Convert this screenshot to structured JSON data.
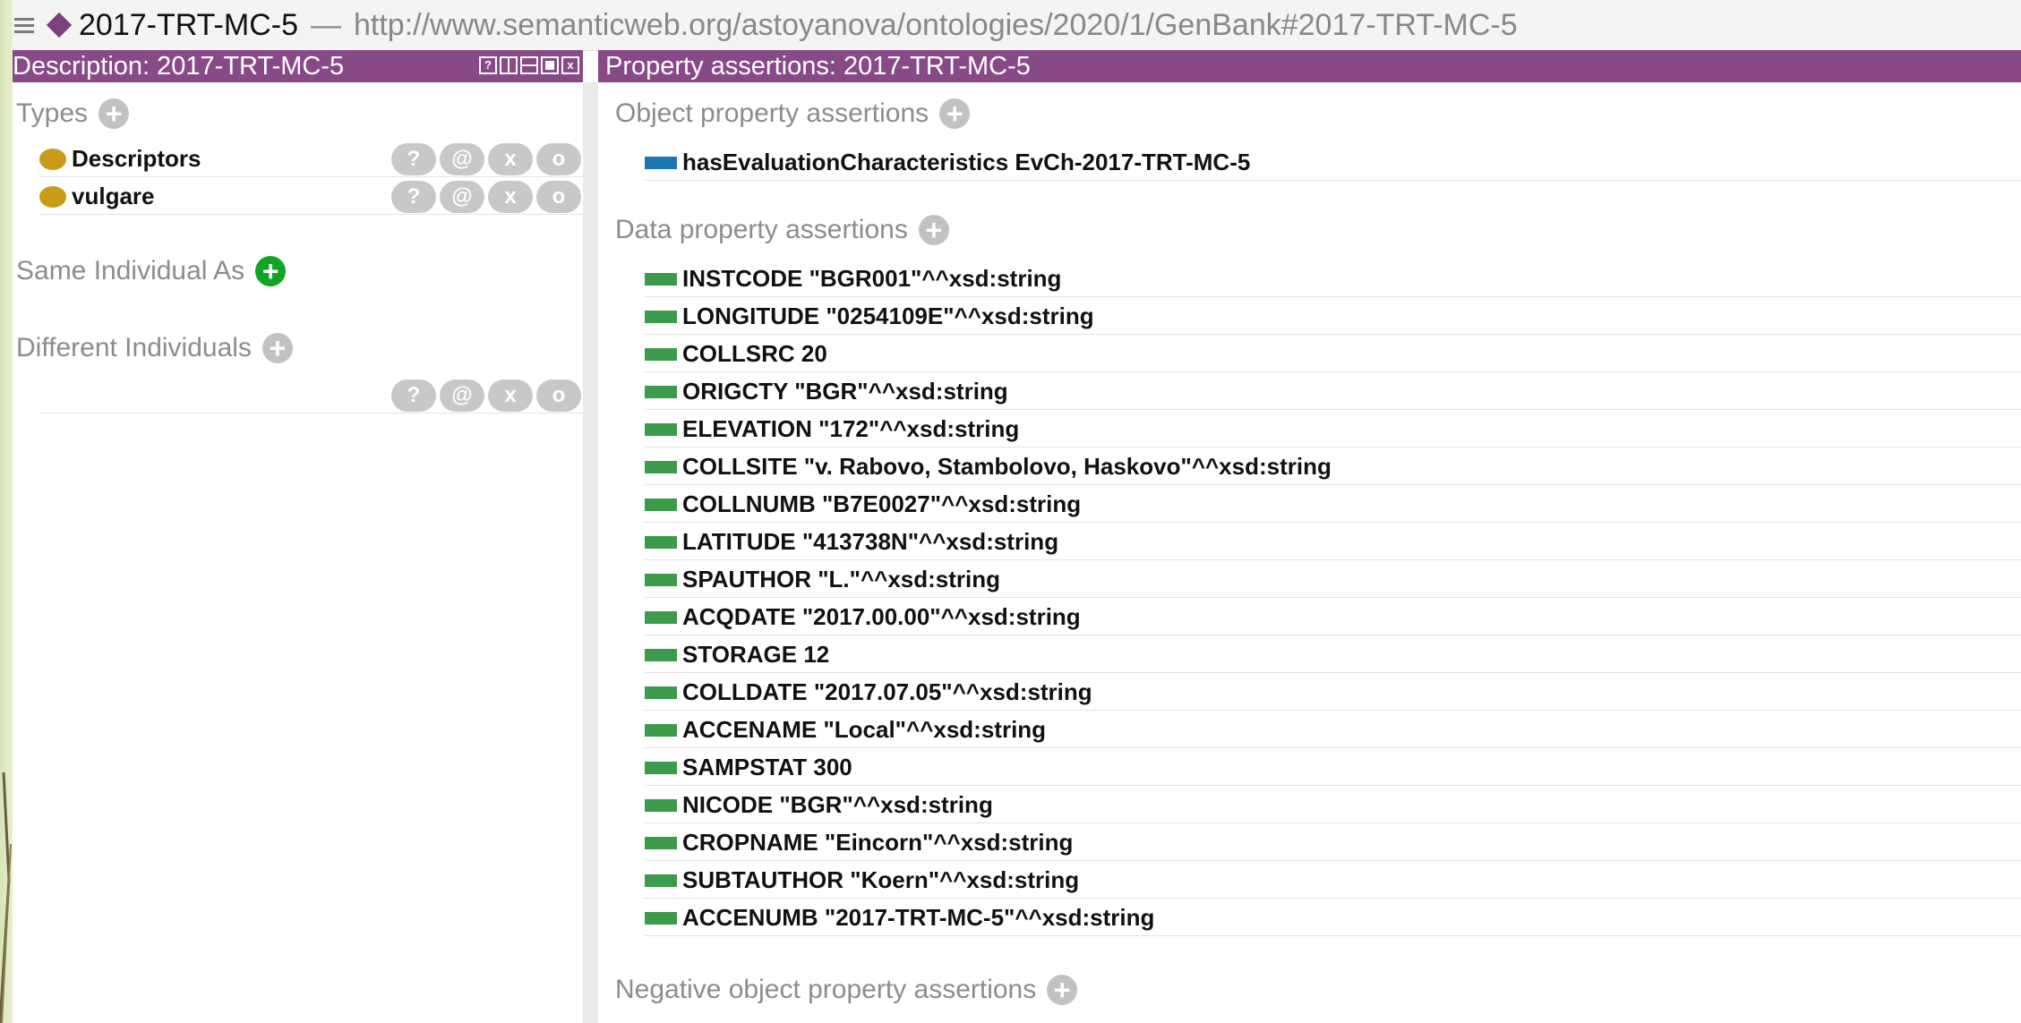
{
  "title_bar": {
    "individual_name": "2017-TRT-MC-5",
    "separator": "—",
    "iri": "http://www.semanticweb.org/astoyanova/ontologies/2020/1/GenBank#2017-TRT-MC-5"
  },
  "description_view": {
    "header": "Description: 2017-TRT-MC-5",
    "header_buttons": [
      "?",
      "",
      "",
      "",
      "x"
    ],
    "types": {
      "title": "Types",
      "items": [
        {
          "label": "Descriptors"
        },
        {
          "label": "vulgare"
        }
      ]
    },
    "same_individual": {
      "title": "Same Individual As"
    },
    "different_individuals": {
      "title": "Different Individuals"
    },
    "row_buttons": {
      "help": "?",
      "annotate": "@",
      "delete": "x",
      "edit": "o"
    }
  },
  "property_view": {
    "header": "Property assertions: 2017-TRT-MC-5",
    "object_properties": {
      "title": "Object property assertions",
      "items": [
        {
          "label": "hasEvaluationCharacteristics  EvCh-2017-TRT-MC-5"
        }
      ]
    },
    "data_properties": {
      "title": "Data property assertions",
      "items": [
        {
          "label": "INSTCODE  \"BGR001\"^^xsd:string"
        },
        {
          "label": "LONGITUDE  \"0254109E\"^^xsd:string"
        },
        {
          "label": "COLLSRC  20"
        },
        {
          "label": "ORIGCTY  \"BGR\"^^xsd:string"
        },
        {
          "label": "ELEVATION  \"172\"^^xsd:string"
        },
        {
          "label": "COLLSITE  \"v. Rabovo, Stambolovo, Haskovo\"^^xsd:string"
        },
        {
          "label": "COLLNUMB  \"B7E0027\"^^xsd:string"
        },
        {
          "label": "LATITUDE  \"413738N\"^^xsd:string"
        },
        {
          "label": "SPAUTHOR  \"L.\"^^xsd:string"
        },
        {
          "label": "ACQDATE  \"2017.00.00\"^^xsd:string"
        },
        {
          "label": "STORAGE  12"
        },
        {
          "label": "COLLDATE  \"2017.07.05\"^^xsd:string"
        },
        {
          "label": "ACCENAME  \"Local\"^^xsd:string"
        },
        {
          "label": "SAMPSTAT  300"
        },
        {
          "label": "NICODE  \"BGR\"^^xsd:string"
        },
        {
          "label": "CROPNAME  \"Eincorn\"^^xsd:string"
        },
        {
          "label": "SUBTAUTHOR  \"Koern\"^^xsd:string"
        },
        {
          "label": "ACCENUMB  \"2017-TRT-MC-5\"^^xsd:string"
        }
      ]
    },
    "negative_object_properties": {
      "title": "Negative object property assertions"
    }
  },
  "colors": {
    "header_bg": "#884a86",
    "class_icon": "#c99c17",
    "object_property": "#1d76b3",
    "data_property": "#3b9b4a",
    "add_green": "#13a326"
  }
}
